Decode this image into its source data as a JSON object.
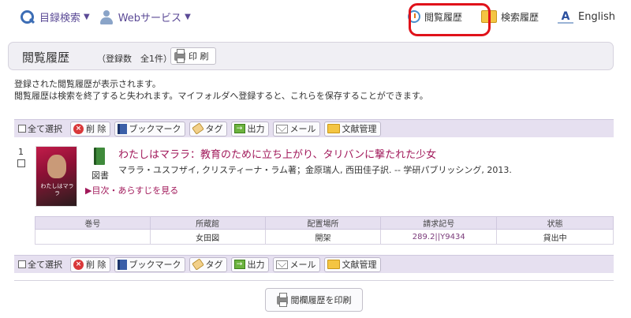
{
  "nav": {
    "catalog_search": "目録検索",
    "web_services": "Webサービス",
    "browse_history": "閲覧履歴",
    "search_history": "検索履歴",
    "english": "English",
    "english_icon_glyph": "A"
  },
  "header": {
    "title": "閲覧履歴",
    "count": "（登録数　全1件）",
    "print_label": "印 刷"
  },
  "info": {
    "line1": "登録された閲覧履歴が表示されます。",
    "line2": "閲覧履歴は検索を終了すると失われます。マイフォルダへ登録すると、これらを保存することができます。"
  },
  "toolbar": {
    "select_all": "全て選択",
    "delete": "削 除",
    "bookmark": "ブックマーク",
    "tag": "タグ",
    "output": "出力",
    "mail": "メール",
    "reference": "文献管理"
  },
  "record": {
    "number": "1",
    "cover_title": "わたしはマララ",
    "material_type": "図書",
    "title": "わたしはマララ：教育のために立ち上がり、タリバンに撃たれた少女",
    "author_line": "マララ・ユスフザイ, クリスティーナ・ラム著；金原瑞人, 西田佳子訳. -- 学研パブリッシング, 2013.",
    "toc_link": "▶目次・あらすじを見る"
  },
  "holdings": {
    "headers": [
      "巻号",
      "所蔵館",
      "配置場所",
      "請求記号",
      "状態"
    ],
    "rows": [
      [
        "",
        "女田図",
        "開架",
        "289.2||Y9434",
        "貸出中"
      ]
    ]
  },
  "footer": {
    "print_history_label": "閲欄履歴を印刷"
  },
  "colors": {
    "accent_purple": "#5b4a96",
    "title_link": "#a1185a",
    "toolbar_bg": "#e6e0f0",
    "highlight_ring": "#e0121a"
  }
}
